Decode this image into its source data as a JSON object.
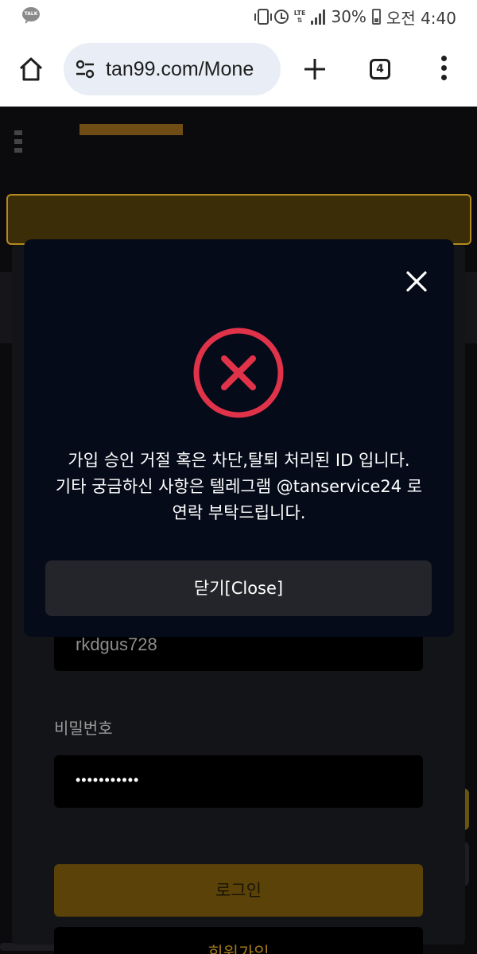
{
  "status_bar": {
    "app_icon_text": "TALK",
    "lte_label": "LTE",
    "battery_percent": "30%",
    "time": "오전 4:40"
  },
  "browser": {
    "url": "tan99.com/Mone",
    "tab_count": "4"
  },
  "login_form": {
    "id_value": "rkdgus728",
    "password_label": "비밀번호",
    "password_value": "•••••••••••",
    "login_label": "로그인",
    "signup_label": "회원가입"
  },
  "modal": {
    "message_lines": [
      "가입 승인 거절 혹은 차단,탈퇴 처리된 ID 입니다.",
      "기타 궁금하신 사항은 텔레그램 @tanservice24 로",
      "연락 부탁드립니다."
    ],
    "close_button_label": "닫기[Close]"
  },
  "colors": {
    "modal_bg": "#050b19",
    "error_red": "#e0334a",
    "gold": "#b38a1e",
    "page_bg": "#0b0b0d"
  }
}
